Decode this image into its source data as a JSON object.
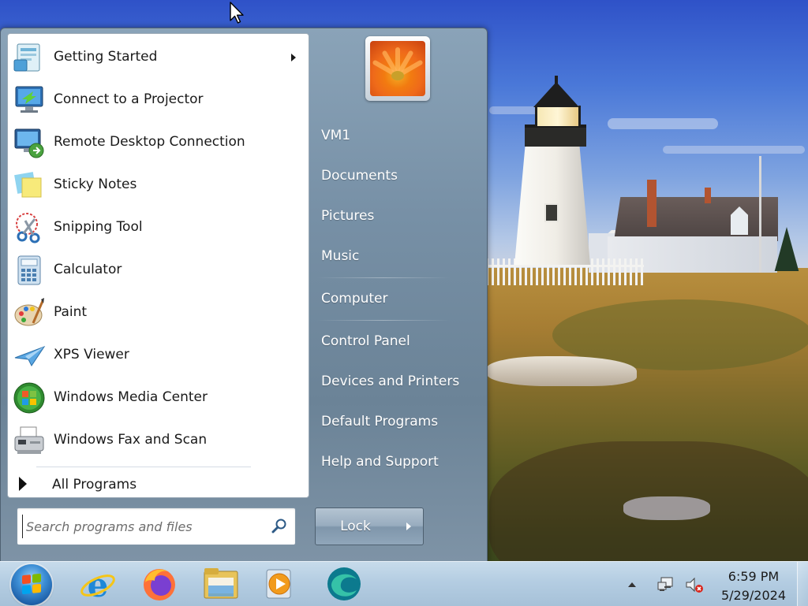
{
  "start_menu": {
    "programs": [
      {
        "label": "Getting Started",
        "icon": "getting-started-icon",
        "has_submenu": true
      },
      {
        "label": "Connect to a Projector",
        "icon": "projector-icon"
      },
      {
        "label": "Remote Desktop Connection",
        "icon": "remote-desktop-icon"
      },
      {
        "label": "Sticky Notes",
        "icon": "sticky-notes-icon"
      },
      {
        "label": "Snipping Tool",
        "icon": "scissors-icon"
      },
      {
        "label": "Calculator",
        "icon": "calculator-icon"
      },
      {
        "label": "Paint",
        "icon": "paint-palette-icon"
      },
      {
        "label": "XPS Viewer",
        "icon": "xps-viewer-icon"
      },
      {
        "label": "Windows Media Center",
        "icon": "media-center-icon"
      },
      {
        "label": "Windows Fax and Scan",
        "icon": "fax-scan-icon"
      }
    ],
    "all_programs_label": "All Programs",
    "search": {
      "placeholder": "Search programs and files",
      "value": ""
    },
    "right_items": [
      "VM1",
      "Documents",
      "Pictures",
      "Music",
      "Computer",
      "Control Panel",
      "Devices and Printers",
      "Default Programs",
      "Help and Support"
    ],
    "lock_label": "Lock"
  },
  "taskbar": {
    "pinned": [
      "internet-explorer-icon",
      "firefox-icon",
      "file-explorer-icon",
      "media-player-icon",
      "edge-icon"
    ],
    "clock": {
      "time": "6:59 PM",
      "date": "5/29/2024"
    },
    "tray": [
      "show-hidden-icons-icon",
      "network-icon",
      "volume-muted-icon"
    ]
  },
  "colors": {
    "start_menu_blue": "#7790a6",
    "taskbar": "#b4cde2",
    "wallpaper_sky": "#4a78d8"
  }
}
